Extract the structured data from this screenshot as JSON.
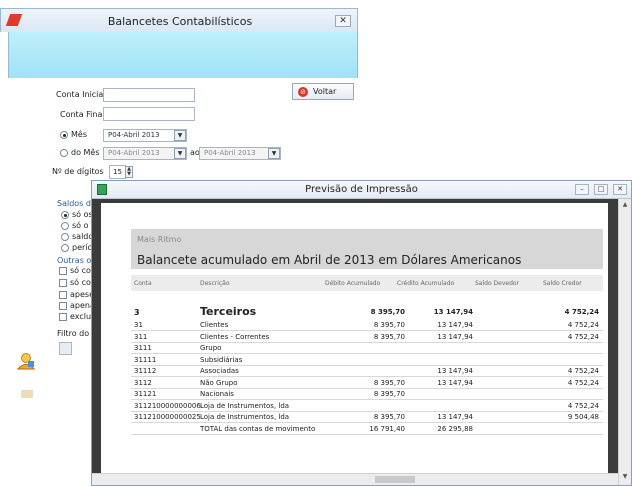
{
  "balancetes": {
    "title": "Balancetes Contabilísticos",
    "close_glyph": "✕",
    "conta_inicial_label": "Conta Inicial",
    "conta_final_label": "Conta Final",
    "mes_label": "Mês",
    "mes_value": "P04-Abril 2013",
    "do_mes_label": "do Mês",
    "do_mes_value": "P04-Abril 2013",
    "ao_label": "ao",
    "ao_value": "P04-Abril 2013",
    "digitos_label": "Nº de dígitos",
    "digitos_value": "15",
    "voltar_label": "Voltar",
    "saldos_group": "Saldos do",
    "saldos_options": [
      "só os",
      "só o s",
      "saldo",
      "perío"
    ],
    "outras_group": "Outras op",
    "outras_options": [
      "só con",
      "só con",
      "apese",
      "apena",
      "exclui"
    ],
    "filtro_label": "Filtro do P"
  },
  "preview": {
    "title": "Previsão de Impressão",
    "min_glyph": "–",
    "max_glyph": "□",
    "close_glyph": "✕",
    "company": "Mais Ritmo",
    "report_title": "Balancete acumulado em Abril de 2013 em Dólares Americanos",
    "columns": {
      "conta": "Conta",
      "descricao": "Descrição",
      "debito": "Débito Acumulado",
      "credito": "Crédito Acumulado",
      "saldo_devedor": "Saldo Devedor",
      "saldo_credor": "Saldo Credor"
    },
    "top_row": {
      "conta": "3",
      "descricao": "Terceiros",
      "debito": "8 395,70",
      "credito": "13 147,94",
      "saldo_credor": "4 752,24"
    },
    "rows": [
      {
        "conta": "31",
        "descricao": "Clientes",
        "debito": "8 395,70",
        "credito": "13 147,94",
        "saldo_credor": "4 752,24"
      },
      {
        "conta": "311",
        "descricao": "Clientes - Correntes",
        "debito": "8 395,70",
        "credito": "13 147,94",
        "saldo_credor": "4 752,24"
      },
      {
        "conta": "3111",
        "descricao": "Grupo",
        "debito": "",
        "credito": "",
        "saldo_credor": ""
      },
      {
        "conta": "31111",
        "descricao": "Subsidiárias",
        "debito": "",
        "credito": "",
        "saldo_credor": ""
      },
      {
        "conta": "31112",
        "descricao": "Associadas",
        "debito": "",
        "credito": "13 147,94",
        "saldo_credor": "4 752,24"
      },
      {
        "conta": "3112",
        "descricao": "Não Grupo",
        "debito": "8 395,70",
        "credito": "13 147,94",
        "saldo_credor": "4 752,24"
      },
      {
        "conta": "31121",
        "descricao": "Nacionais",
        "debito": "8 395,70",
        "credito": "",
        "saldo_credor": ""
      },
      {
        "conta": "311210000000006",
        "descricao": "Loja de Instrumentos, lda",
        "debito": "",
        "credito": "",
        "saldo_credor": "4 752,24"
      },
      {
        "conta": "311210000000025",
        "descricao": "Loja de Instrumentos, lda",
        "debito": "8 395,70",
        "credito": "13 147,94",
        "saldo_credor": "9 504,48"
      },
      {
        "conta": "",
        "descricao": "TOTAL das contas de movimento",
        "debito": "16 791,40",
        "credito": "26 295,88",
        "saldo_credor": ""
      }
    ]
  },
  "colors": {
    "title_band": "#a0e2f7",
    "preview_frame": "#3b3b3b",
    "page_header": "#d7d7d7"
  },
  "icons": [
    "app-red-icon",
    "close-icon",
    "voltar-icon",
    "dropdown-arrow-icon",
    "spin-icon",
    "preview-app-icon",
    "minimize-icon",
    "maximize-icon",
    "user-icon",
    "small-tool-icon"
  ]
}
